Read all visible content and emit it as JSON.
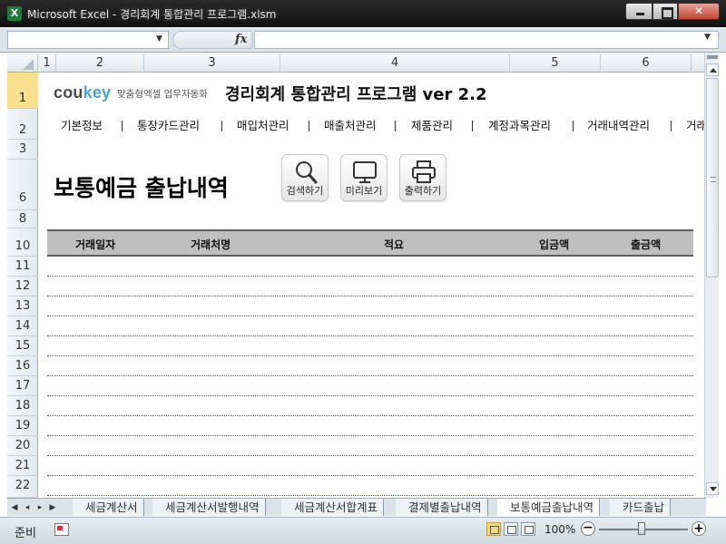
{
  "window": {
    "title": "Microsoft Excel - 경리회계 통합관리 프로그램.xlsm",
    "app_icon": "X"
  },
  "formula_bar": {
    "fx": "fx"
  },
  "columns": [
    "1",
    "2",
    "3",
    "4",
    "5",
    "6"
  ],
  "rows": [
    "1",
    "2",
    "3",
    "6",
    "8",
    "10",
    "11",
    "12",
    "13",
    "14",
    "15",
    "16",
    "17",
    "18",
    "19",
    "20",
    "21",
    "22"
  ],
  "brand": {
    "co": "cou",
    "key": "key",
    "tagline": "맞춤형엑셀 업무자동화",
    "key_color": "#4aa3d8"
  },
  "app_title": "경리회계 통합관리 프로그램 ver 2.2",
  "menu": [
    "기본정보",
    "통장카드관리",
    "매입처관리",
    "매출처관리",
    "제품관리",
    "계정과목관리",
    "거래내역관리",
    "거래"
  ],
  "page_heading": "보통예금 출납내역",
  "actions": {
    "search": "검색하기",
    "preview": "미리보기",
    "print": "출력하기"
  },
  "table": {
    "headers": [
      "거래일자",
      "거래처명",
      "적요",
      "입금액",
      "출금액"
    ],
    "header_bg": "#bfbfbf"
  },
  "sheet_tabs": [
    "세금계산서",
    "세금계산서발행내역",
    "세금계산서합계표",
    "결제별출납내역",
    "보통예금출납내역",
    "카드출납"
  ],
  "active_tab": "보통예금출납내역",
  "status": {
    "ready": "준비",
    "zoom": "100%",
    "zoom_minus": "−",
    "zoom_plus": "+"
  }
}
